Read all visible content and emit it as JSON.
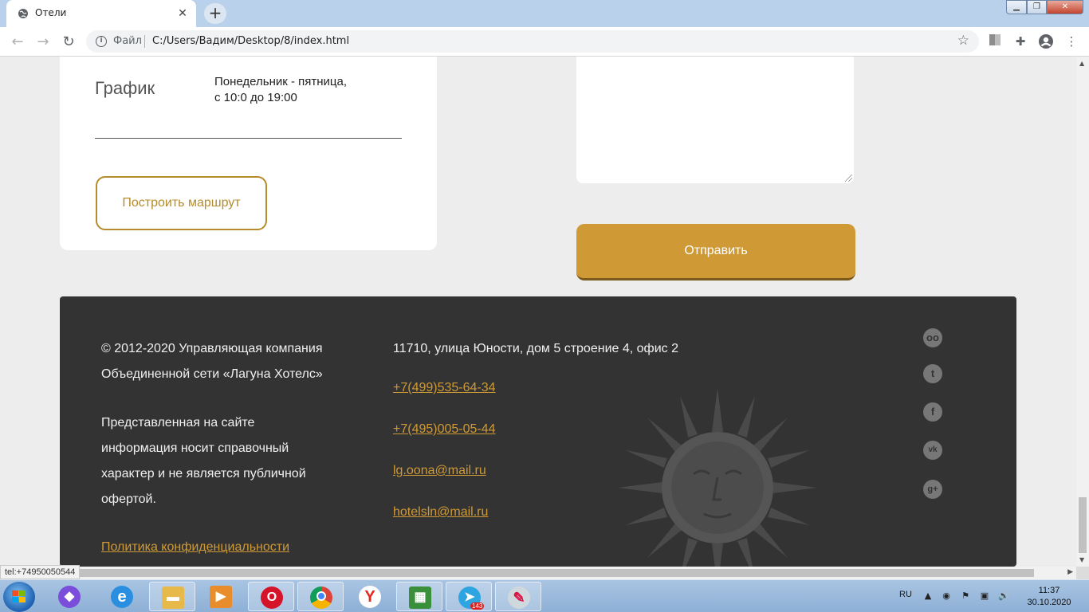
{
  "browser": {
    "tab_title": "Отели",
    "url_scheme_label": "Файл",
    "url": "C:/Users/Вадим/Desktop/8/index.html",
    "status_tooltip": "tel:+74950050544"
  },
  "contacts": {
    "schedule_label": "График",
    "schedule_line1": "Понедельник - пятница,",
    "schedule_line2": "с 10:0 до 19:00",
    "route_button": "Построить маршрут"
  },
  "form": {
    "send_button": "Отправить"
  },
  "footer": {
    "copyright_line1": "© 2012-2020 Управляющая компания",
    "copyright_line2": "Объединенной сети «Лагуна Хотелс»",
    "disclaimer": [
      "Представленная на сайте",
      "информация носит справочный",
      "характер и не является публичной",
      "офертой."
    ],
    "privacy_link": "Политика конфиденциальности",
    "address": "11710, улица Юности, дом 5 строение 4, офис 2",
    "phone1": "+7(499)535-64-34",
    "phone2": "+7(495)005-05-44",
    "email1": "lg.oona@mail.ru",
    "email2": "hotelsln@mail.ru",
    "social": [
      {
        "name": "tripadvisor-icon",
        "glyph": "oo"
      },
      {
        "name": "twitter-icon",
        "glyph": "t"
      },
      {
        "name": "facebook-icon",
        "glyph": "f"
      },
      {
        "name": "vk-icon",
        "glyph": "vk"
      },
      {
        "name": "google-plus-icon",
        "glyph": "g+"
      }
    ],
    "accent_color": "#cf9a35"
  },
  "taskbar": {
    "language": "RU",
    "time": "11:37",
    "date": "30.10.2020",
    "telegram_badge": "143"
  }
}
